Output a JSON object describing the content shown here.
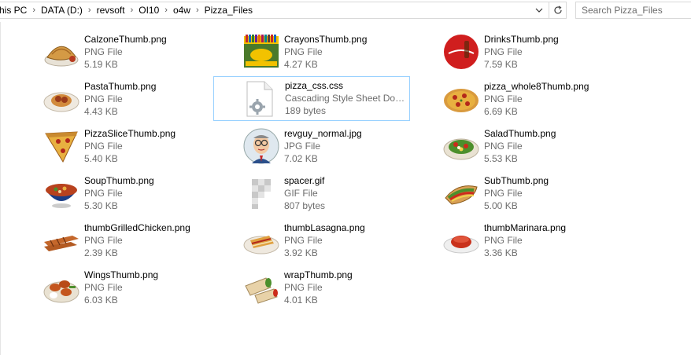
{
  "address_bar": {
    "crumbs": [
      "his PC",
      "DATA (D:)",
      "revsoft",
      "OI10",
      "o4w",
      "Pizza_Files"
    ]
  },
  "search": {
    "placeholder": "Search Pizza_Files"
  },
  "files": [
    {
      "name": "CalzoneThumb.png",
      "type": "PNG File",
      "size": "5.19 KB",
      "icon": "calzone-thumbnail"
    },
    {
      "name": "CrayonsThumb.png",
      "type": "PNG File",
      "size": "4.27 KB",
      "icon": "crayons-thumbnail"
    },
    {
      "name": "DrinksThumb.png",
      "type": "PNG File",
      "size": "7.59 KB",
      "icon": "cola-thumbnail"
    },
    {
      "name": "PastaThumb.png",
      "type": "PNG File",
      "size": "4.43 KB",
      "icon": "pasta-thumbnail"
    },
    {
      "name": "pizza_css.css",
      "type": "Cascading Style Sheet Doc...",
      "size": "189 bytes",
      "icon": "css-file-icon"
    },
    {
      "name": "pizza_whole8Thumb.png",
      "type": "PNG File",
      "size": "6.69 KB",
      "icon": "whole-pizza-thumbnail"
    },
    {
      "name": "PizzaSliceThumb.png",
      "type": "PNG File",
      "size": "5.40 KB",
      "icon": "pizza-slice-thumbnail"
    },
    {
      "name": "revguy_normal.jpg",
      "type": "JPG File",
      "size": "7.02 KB",
      "icon": "cartoon-man-thumbnail"
    },
    {
      "name": "SaladThumb.png",
      "type": "PNG File",
      "size": "5.53 KB",
      "icon": "salad-thumbnail"
    },
    {
      "name": "SoupThumb.png",
      "type": "PNG File",
      "size": "5.30 KB",
      "icon": "soup-thumbnail"
    },
    {
      "name": "spacer.gif",
      "type": "GIF File",
      "size": "807 bytes",
      "icon": "transparent-gif-thumbnail"
    },
    {
      "name": "SubThumb.png",
      "type": "PNG File",
      "size": "5.00 KB",
      "icon": "sub-sandwich-thumbnail"
    },
    {
      "name": "thumbGrilledChicken.png",
      "type": "PNG File",
      "size": "2.39 KB",
      "icon": "grilled-chicken-thumbnail"
    },
    {
      "name": "thumbLasagna.png",
      "type": "PNG File",
      "size": "3.92 KB",
      "icon": "lasagna-thumbnail"
    },
    {
      "name": "thumbMarinara.png",
      "type": "PNG File",
      "size": "3.36 KB",
      "icon": "marinara-thumbnail"
    },
    {
      "name": "WingsThumb.png",
      "type": "PNG File",
      "size": "6.03 KB",
      "icon": "wings-thumbnail"
    },
    {
      "name": "wrapThumb.png",
      "type": "PNG File",
      "size": "4.01 KB",
      "icon": "wrap-thumbnail"
    }
  ],
  "selected_file": "pizza_css.css"
}
